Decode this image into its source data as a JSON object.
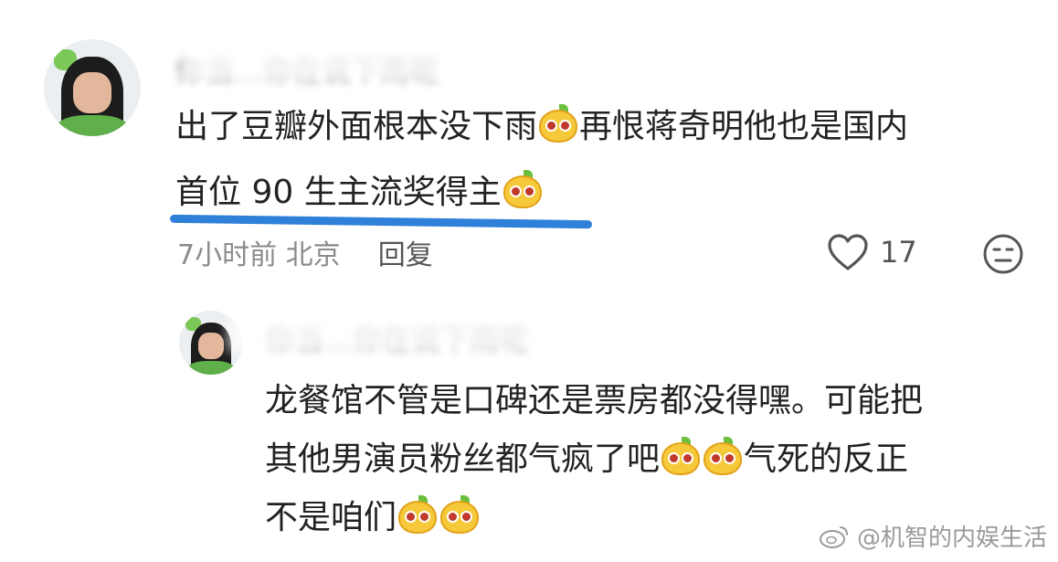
{
  "comment": {
    "username": "你当…你在说下雨呢",
    "text_line1_a": "出了豆瓣外面根本没下雨",
    "text_line1_b": "再恨蒋奇明他也是国内",
    "text_line2": "首位 90 生主流奖得主",
    "time": "7小时前",
    "location": "北京",
    "reply_label": "回复",
    "like_count": "17",
    "icons": [
      "emoji-mango-icon",
      "heart-icon",
      "neutral-face-icon"
    ]
  },
  "reply": {
    "username": "你当…你在说下雨呢",
    "text_line1": "龙餐馆不管是口碑还是票房都没得嘿。可能把",
    "text_line2_a": "其他男演员粉丝都气疯了吧",
    "text_line2_b": "气死的反正",
    "text_line3": "不是咱们"
  },
  "watermark": {
    "text": "@机智的内娱生活",
    "icon": "weibo-logo-icon"
  },
  "colors": {
    "underline": "#2f80d8",
    "meta_text": "#8b8b8b"
  }
}
